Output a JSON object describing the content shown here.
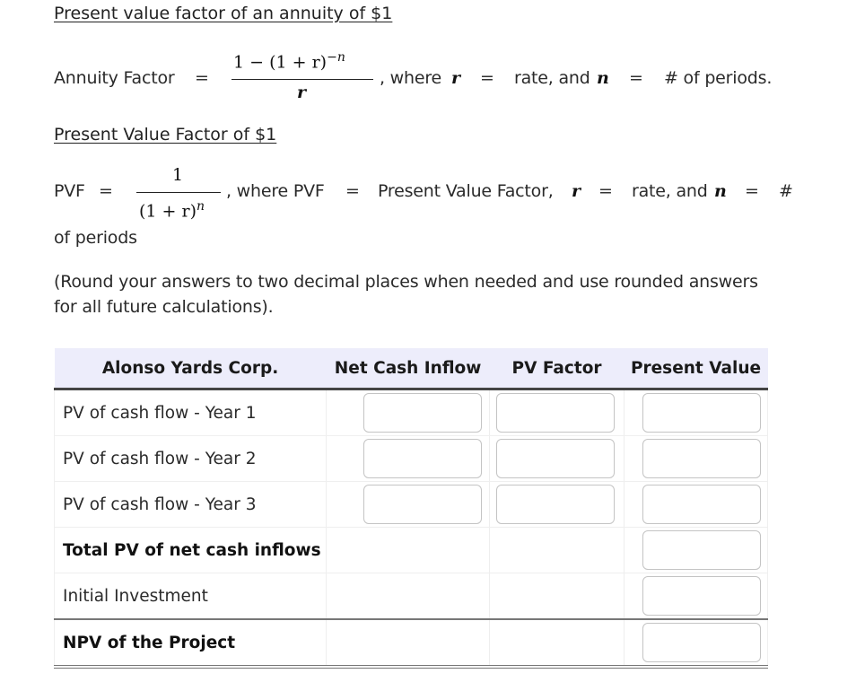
{
  "section1": {
    "heading": "Present value factor of an annuity of $1",
    "label": "Annuity Factor",
    "equals": "=",
    "numerator": "1 − (1 + r)",
    "numerator_exp": "−n",
    "denominator": "r",
    "where_text": ", where",
    "var_r": "r",
    "eq2": "=",
    "rate_text": "rate, and",
    "var_n": "n",
    "eq3": "=",
    "periods_text": "# of periods."
  },
  "section2": {
    "heading": "Present Value Factor of $1",
    "label": "PVF",
    "equals": "=",
    "numerator": "1",
    "denominator": "(1 + r)",
    "denominator_exp": "n",
    "where_text": ", where PVF",
    "eq2": "=",
    "pvf_text": "Present Value Factor,",
    "var_r": "r",
    "eq3": "=",
    "rate_text": "rate, and",
    "var_n": "n",
    "eq4": "=",
    "hash": "#",
    "wrap_text": "of periods"
  },
  "instructions": {
    "line1": "(Round your answers to two decimal places when needed and use rounded answers",
    "line2": "for all future calculations)."
  },
  "table": {
    "headers": [
      "Alonso Yards Corp.",
      "Net Cash Inflow",
      "PV Factor",
      "Present Value"
    ],
    "rows": [
      {
        "label": "PV of cash flow - Year 1",
        "net_cash_inflow": "",
        "pv_factor": "",
        "present_value": ""
      },
      {
        "label": "PV of cash flow - Year 2",
        "net_cash_inflow": "",
        "pv_factor": "",
        "present_value": ""
      },
      {
        "label": "PV of cash flow - Year 3",
        "net_cash_inflow": "",
        "pv_factor": "",
        "present_value": ""
      },
      {
        "label": "Total PV of net cash inflows",
        "present_value": ""
      },
      {
        "label": "Initial Investment",
        "present_value": ""
      },
      {
        "label": "NPV of the Project",
        "present_value": ""
      }
    ]
  }
}
